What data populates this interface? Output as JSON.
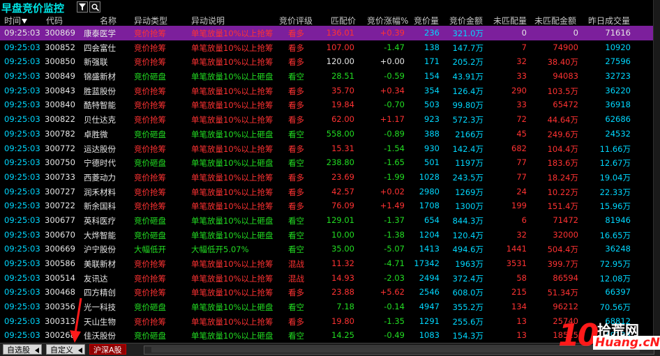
{
  "app_title": "早盘竞价监控",
  "toolbar": {
    "filter_icon": "filter-icon",
    "search_icon": "search-icon"
  },
  "columns": [
    "时间",
    "代码",
    "名称",
    "异动类型",
    "异动说明",
    "竞价评级",
    "匹配价",
    "竞价涨幅%",
    "竞价量",
    "竞价金额",
    "未匹配量",
    "未匹配金额",
    "昨日成交量"
  ],
  "rows": [
    [
      "09:25:03",
      "300869",
      "康泰医学",
      "竞价抢筹",
      "单笔放量10%以上抢筹",
      "看多",
      "136.01",
      "+0.39",
      "236",
      "321.0万",
      "0",
      "0",
      "71616"
    ],
    [
      "09:25:03",
      "300852",
      "四会富仕",
      "竞价抢筹",
      "单笔放量10%以上抢筹",
      "看多",
      "107.00",
      "-1.47",
      "138",
      "147.7万",
      "7",
      "74900",
      "10920"
    ],
    [
      "09:25:03",
      "300850",
      "新强联",
      "竞价抢筹",
      "单笔放量10%以上抢筹",
      "看多",
      "120.00",
      "+0.00",
      "171",
      "205.2万",
      "32",
      "38.40万",
      "27596"
    ],
    [
      "09:25:03",
      "300849",
      "锦盛新材",
      "竞价砸盘",
      "单笔放量10%以上砸盘",
      "看空",
      "28.51",
      "-0.59",
      "154",
      "43.91万",
      "33",
      "94083",
      "32723"
    ],
    [
      "09:25:03",
      "300843",
      "胜蓝股份",
      "竞价抢筹",
      "单笔放量10%以上抢筹",
      "看多",
      "35.70",
      "+0.34",
      "354",
      "126.4万",
      "290",
      "103.5万",
      "36220"
    ],
    [
      "09:25:03",
      "300840",
      "酷特智能",
      "竞价抢筹",
      "单笔放量10%以上抢筹",
      "看多",
      "19.84",
      "-0.70",
      "503",
      "99.80万",
      "33",
      "65472",
      "36918"
    ],
    [
      "09:25:03",
      "300822",
      "贝仕达克",
      "竞价抢筹",
      "单笔放量10%以上抢筹",
      "看多",
      "62.00",
      "+1.17",
      "923",
      "572.3万",
      "72",
      "44.64万",
      "62686"
    ],
    [
      "09:25:03",
      "300782",
      "卓胜微",
      "竞价砸盘",
      "单笔放量10%以上砸盘",
      "看空",
      "558.00",
      "-0.89",
      "388",
      "2166万",
      "45",
      "249.6万",
      "24532"
    ],
    [
      "09:25:03",
      "300772",
      "运达股份",
      "竞价抢筹",
      "单笔放量10%以上抢筹",
      "看多",
      "15.31",
      "-1.54",
      "930",
      "142.4万",
      "682",
      "104.4万",
      "11.66万"
    ],
    [
      "09:25:03",
      "300750",
      "宁德时代",
      "竞价砸盘",
      "单笔放量10%以上砸盘",
      "看空",
      "238.80",
      "-1.65",
      "501",
      "1197万",
      "77",
      "183.6万",
      "12.67万"
    ],
    [
      "09:25:03",
      "300733",
      "西菱动力",
      "竞价抢筹",
      "单笔放量10%以上抢筹",
      "看多",
      "23.69",
      "-1.99",
      "1028",
      "243.5万",
      "77",
      "18.24万",
      "19.04万"
    ],
    [
      "09:25:03",
      "300727",
      "润禾材料",
      "竞价抢筹",
      "单笔放量10%以上抢筹",
      "看多",
      "42.57",
      "+0.02",
      "2980",
      "1269万",
      "24",
      "10.22万",
      "22.33万"
    ],
    [
      "09:25:03",
      "300722",
      "新余国科",
      "竞价抢筹",
      "单笔放量10%以上抢筹",
      "看多",
      "76.09",
      "+1.49",
      "1708",
      "1300万",
      "199",
      "151.4万",
      "15.96万"
    ],
    [
      "09:25:03",
      "300677",
      "英科医疗",
      "竞价砸盘",
      "单笔放量10%以上砸盘",
      "看空",
      "129.01",
      "-1.37",
      "654",
      "844.3万",
      "6",
      "71472",
      "81946"
    ],
    [
      "09:25:03",
      "300670",
      "大烨智能",
      "竞价砸盘",
      "单笔放量10%以上砸盘",
      "看空",
      "10.00",
      "-1.38",
      "1204",
      "120.4万",
      "32",
      "32000",
      "16.65万"
    ],
    [
      "09:25:03",
      "300669",
      "沪宁股份",
      "大幅低开",
      "大幅低开5.07%",
      "看空",
      "35.00",
      "-5.07",
      "1413",
      "494.6万",
      "1441",
      "504.4万",
      "36248"
    ],
    [
      "09:25:03",
      "300586",
      "美联新材",
      "竞价抢筹",
      "单笔放量10%以上抢筹",
      "混战",
      "11.32",
      "-4.71",
      "17342",
      "1963万",
      "3531",
      "399.7万",
      "72.95万"
    ],
    [
      "09:25:03",
      "300514",
      "友讯达",
      "竞价抢筹",
      "单笔放量10%以上抢筹",
      "混战",
      "14.93",
      "-2.03",
      "2494",
      "372.4万",
      "58",
      "86594",
      "12.08万"
    ],
    [
      "09:25:03",
      "300468",
      "四方精创",
      "竞价抢筹",
      "单笔放量10%以上抢筹",
      "看多",
      "23.88",
      "+5.62",
      "2546",
      "608.0万",
      "215",
      "51.34万",
      "66397"
    ],
    [
      "09:25:03",
      "300356",
      "光一科技",
      "竞价砸盘",
      "单笔放量10%以上砸盘",
      "看空",
      "7.18",
      "-0.14",
      "4947",
      "355.2万",
      "134",
      "96212",
      "70.56万"
    ],
    [
      "09:25:03",
      "300313",
      "天山生物",
      "竞价抢筹",
      "单笔放量10%以上抢筹",
      "看多",
      "19.80",
      "-1.35",
      "1291",
      "255.6万",
      "13",
      "25740",
      "68812"
    ],
    [
      "09:25:03",
      "300268",
      "佳沃股份",
      "竞价砸盘",
      "单笔放量10%以上砸盘",
      "看空",
      "14.25",
      "-0.49",
      "1083",
      "154.3万",
      "13",
      "18525",
      "49133"
    ]
  ],
  "selected_row": 0,
  "tabs": {
    "t1": "自选股",
    "t2": "自定义",
    "t3": "沪深A股"
  },
  "logo": {
    "digits": "10",
    "cn": "拾荒网",
    "en": "Huang.cN"
  },
  "colors": {
    "accent": "#00e5e5",
    "up": "#ff3232",
    "down": "#22dd22",
    "selected": "#7c1f9c"
  }
}
